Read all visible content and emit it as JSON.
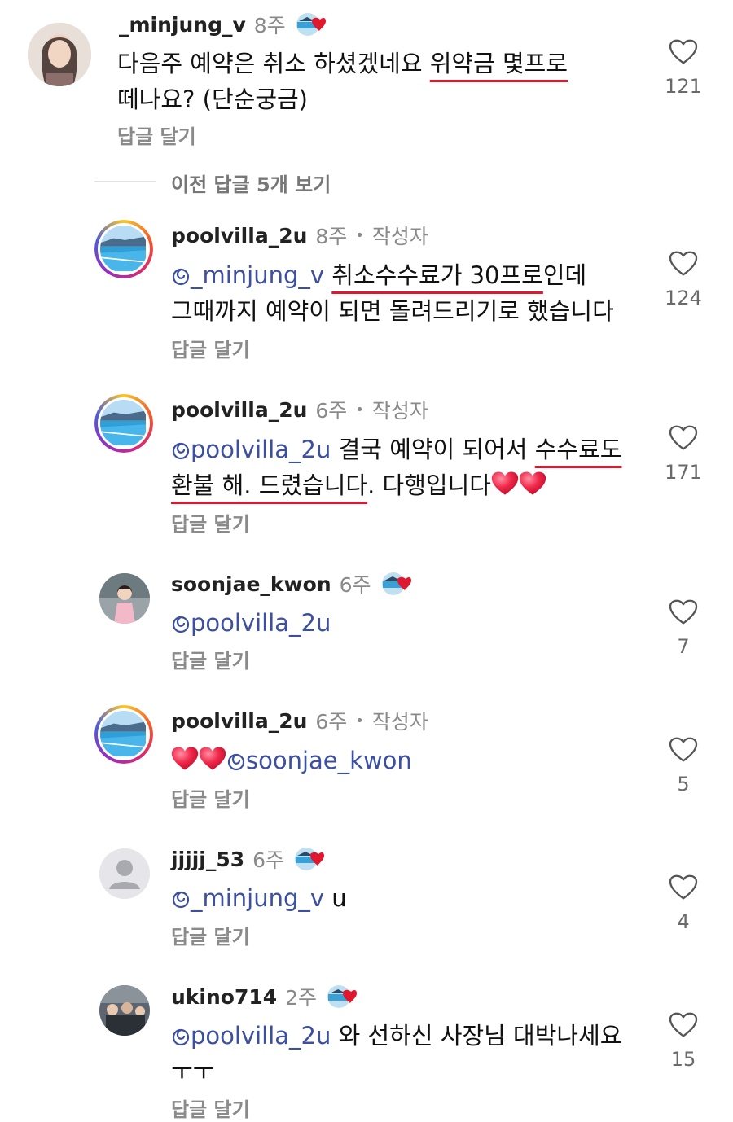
{
  "view_previous_replies": "이전 답글 5개 보기",
  "reply_label": "답글 달기",
  "mention_prefix": "@",
  "comments": [
    {
      "username": "_minjung_v",
      "time": "8주",
      "badge_icon": "poolvilla-heart-badge",
      "text_plain_1": "다음주 예약은 취소 하셨겠네요 ",
      "text_underlined_1": "위약금 몇프로",
      "text_plain_2": "떼나요? (단순궁금)",
      "likes": "121"
    },
    {
      "username": "poolvilla_2u",
      "time": "8주",
      "author_tag": "작성자",
      "mention": "_minjung_v",
      "text_underlined_1": "취소수수료가 30프로",
      "text_plain_1": "인데",
      "text_plain_2": "그때까지 예약이 되면 돌려드리기로 했습니다",
      "likes": "124"
    },
    {
      "username": "poolvilla_2u",
      "time": "6주",
      "author_tag": "작성자",
      "mention": "poolvilla_2u",
      "text_plain_1": "결국 예약이 되어서 ",
      "text_underlined_1": "수수료도",
      "text_underlined_2": "환불 해. 드렸습니다",
      "text_plain_2": ". 다행입니다",
      "emoji": "heart-emoji x2",
      "likes": "171"
    },
    {
      "username": "soonjae_kwon",
      "time": "6주",
      "badge_icon": "poolvilla-heart-badge",
      "mention": "poolvilla_2u",
      "likes": "7"
    },
    {
      "username": "poolvilla_2u",
      "time": "6주",
      "author_tag": "작성자",
      "emoji": "heart-emoji x2",
      "mention": "soonjae_kwon",
      "likes": "5"
    },
    {
      "username": "jjjjj_53",
      "time": "6주",
      "badge_icon": "poolvilla-heart-badge",
      "mention": "_minjung_v",
      "text_plain_1": " u",
      "likes": "4"
    },
    {
      "username": "ukino714",
      "time": "2주",
      "badge_icon": "poolvilla-heart-badge",
      "mention": "poolvilla_2u",
      "text_plain_1": " 와 선하신 사장님 대박나세요",
      "text_plain_2": "ㅜㅜ",
      "likes": "15"
    }
  ],
  "colors": {
    "mention": "#3c4fa0",
    "underline": "#e0182d",
    "heart_emoji": "#f0284a",
    "muted": "#8a8a8a"
  }
}
